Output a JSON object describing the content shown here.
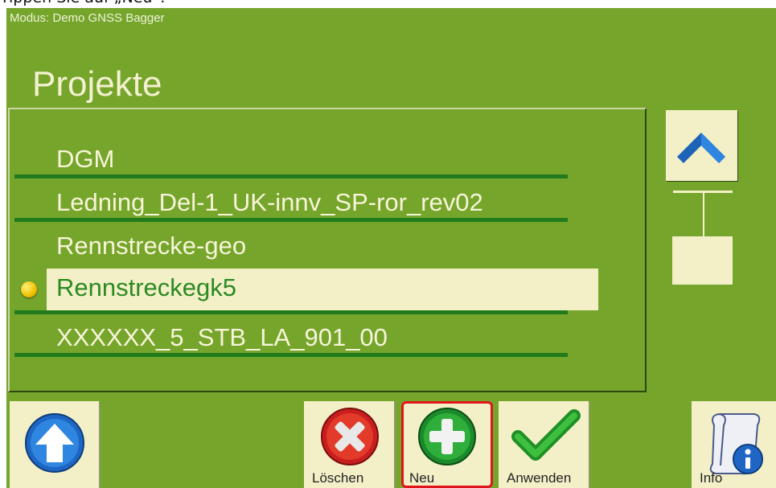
{
  "caption": "Tippen Sie auf „Neu“.",
  "mode": "Modus: Demo GNSS Bagger",
  "title": "Projekte",
  "projects": [
    {
      "name": "DGM",
      "selected": false
    },
    {
      "name": "Ledning_Del-1_UK-innv_SP-ror_rev02",
      "selected": false
    },
    {
      "name": "Rennstrecke-geo",
      "selected": false
    },
    {
      "name": "Rennstreckegk5",
      "selected": true
    },
    {
      "name": "XXXXXX_5_STB_LA_901_00",
      "selected": false
    }
  ],
  "buttons": {
    "back_icon": "arrow-up-circle-icon",
    "delete_label": "Löschen",
    "new_label": "Neu",
    "apply_label": "Anwenden",
    "info_label": "Info"
  },
  "colors": {
    "background": "#76a52c",
    "panel_text": "#f7f4d8",
    "selection": "#f3f0c8",
    "separator": "#217a1c",
    "highlight_box": "#e0151b"
  }
}
